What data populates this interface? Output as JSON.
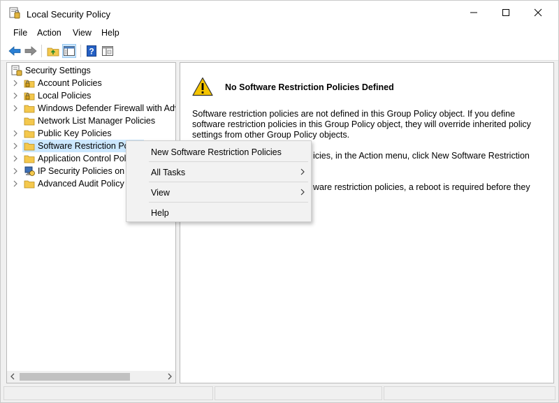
{
  "window": {
    "title": "Local Security Policy",
    "controls": [
      "minimize",
      "maximize",
      "close"
    ]
  },
  "menubar": {
    "items": [
      "File",
      "Action",
      "View",
      "Help"
    ]
  },
  "toolbar": {
    "icons": [
      "back-arrow-icon",
      "forward-arrow-icon",
      "up-folder-icon",
      "show-hide-tree-icon",
      "help-icon",
      "properties-icon"
    ]
  },
  "tree": {
    "root": "Security Settings",
    "items": [
      {
        "label": "Account Policies",
        "icon": "folder-lock-icon"
      },
      {
        "label": "Local Policies",
        "icon": "folder-lock-icon"
      },
      {
        "label": "Windows Defender Firewall with Adva",
        "icon": "folder-icon"
      },
      {
        "label": "Network List Manager Policies",
        "icon": "folder-icon"
      },
      {
        "label": "Public Key Policies",
        "icon": "folder-icon"
      },
      {
        "label": "Software Restriction Poli",
        "icon": "folder-icon"
      },
      {
        "label": "Application Control Poli",
        "icon": "folder-icon"
      },
      {
        "label": "IP Security Policies on Lo",
        "icon": "ip-security-icon"
      },
      {
        "label": "Advanced Audit Policy C",
        "icon": "folder-icon"
      }
    ]
  },
  "details": {
    "heading": "No Software Restriction Policies Defined",
    "paragraph1": [
      "Software restriction policies are not defined in this Group Policy object. If you define",
      "software restriction policies in this Group Policy object, they will override inherited policy",
      "settings from other Group Policy objects."
    ],
    "paragraph2_visible": "icies, in the Action menu, click New Software Restriction",
    "paragraph3_visible": "ware restriction policies, a reboot is required before they"
  },
  "context_menu": {
    "items": [
      {
        "label": "New Software Restriction Policies",
        "submenu": false
      },
      {
        "label": "All Tasks",
        "submenu": true
      },
      {
        "label": "View",
        "submenu": true
      },
      {
        "label": "Help",
        "submenu": false
      }
    ]
  },
  "colors": {
    "selection": "#cce8ff",
    "folder": "#f4c84d",
    "warning": "#f5c400",
    "help_blue": "#2460c4"
  }
}
